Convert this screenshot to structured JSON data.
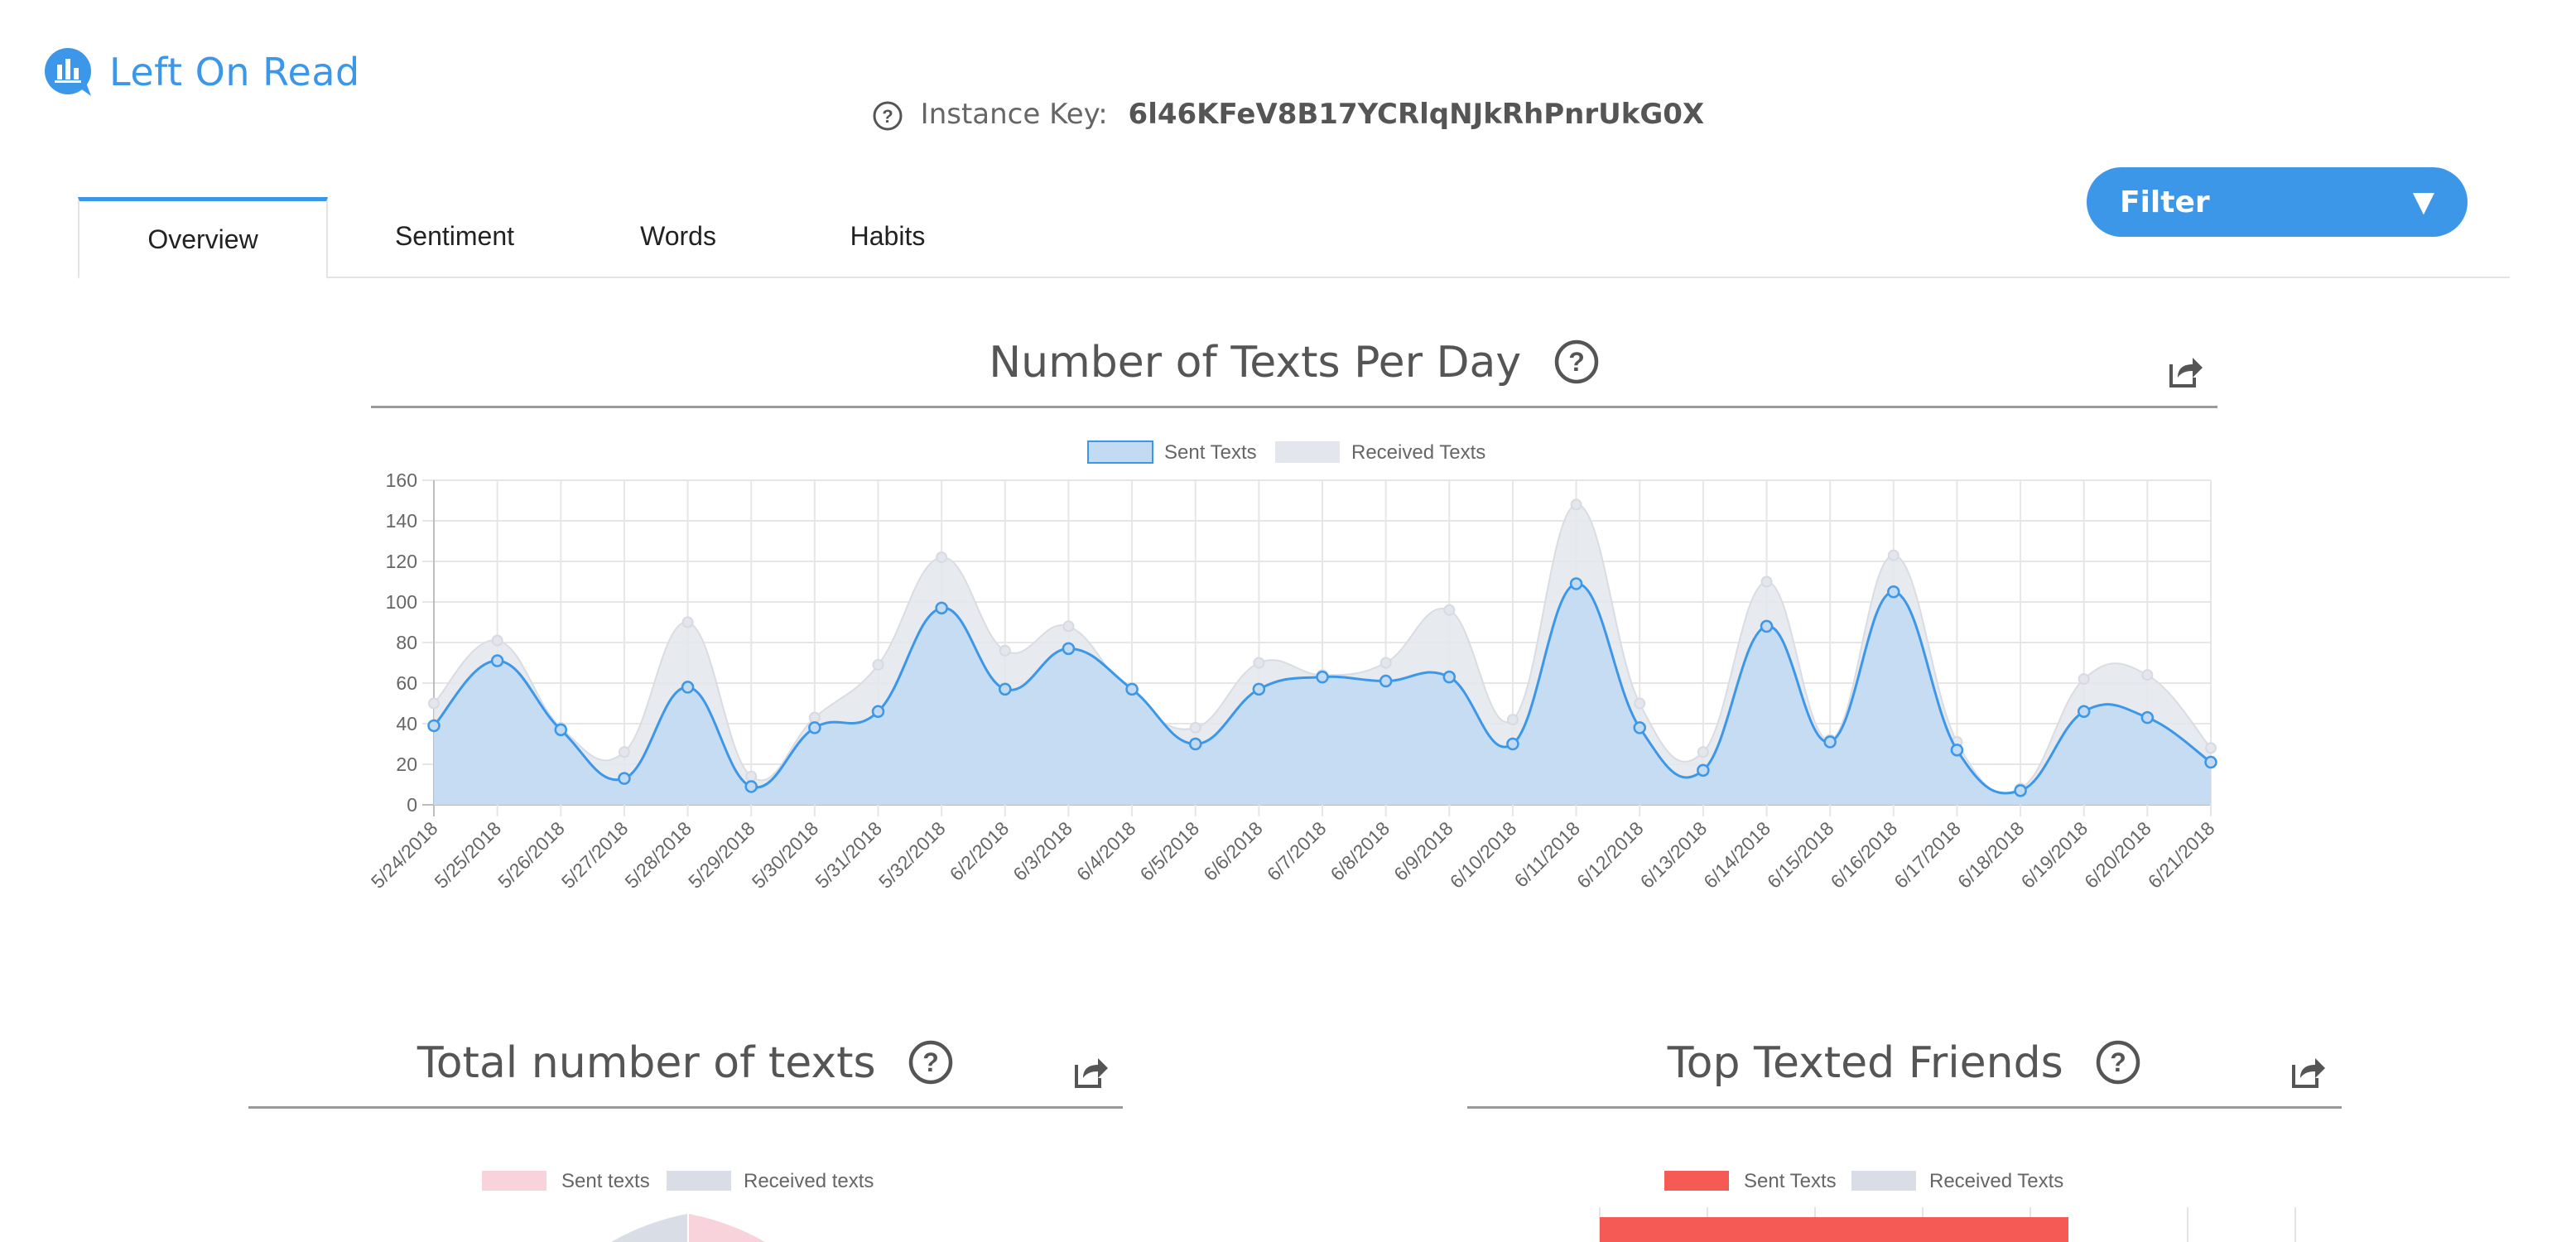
{
  "app": {
    "name": "Left On Read"
  },
  "instance": {
    "label": "Instance Key:",
    "key": "6l46KFeV8B17YCRlqNJkRhPnrUkG0X"
  },
  "tabs": [
    {
      "label": "Overview",
      "active": true
    },
    {
      "label": "Sentiment",
      "active": false
    },
    {
      "label": "Words",
      "active": false
    },
    {
      "label": "Habits",
      "active": false
    }
  ],
  "filter": {
    "label": "Filter",
    "arrow": "▼"
  },
  "sections": {
    "texts_per_day": {
      "title": "Number of Texts Per Day"
    },
    "total_texts": {
      "title": "Total number of texts",
      "legend": [
        "Sent texts",
        "Received texts"
      ]
    },
    "top_friends": {
      "title": "Top Texted Friends",
      "legend": [
        "Sent Texts",
        "Received Texts"
      ]
    }
  },
  "colors": {
    "accent": "#3d97e8",
    "sent_fill": "#c2daf2",
    "received_fill": "#e3e6ec",
    "sent_pink": "#f8d3dc",
    "received_gray": "#d8dde6",
    "friends_sent": "#f65a55",
    "friends_received": "#d8dde6"
  },
  "chart_data": {
    "type": "area",
    "title": "Number of Texts Per Day",
    "x": [
      "5/24/2018",
      "5/25/2018",
      "5/26/2018",
      "5/27/2018",
      "5/28/2018",
      "5/29/2018",
      "5/30/2018",
      "5/31/2018",
      "5/32/2018",
      "6/2/2018",
      "6/3/2018",
      "6/4/2018",
      "6/5/2018",
      "6/6/2018",
      "6/7/2018",
      "6/8/2018",
      "6/9/2018",
      "6/10/2018",
      "6/11/2018",
      "6/12/2018",
      "6/13/2018",
      "6/14/2018",
      "6/15/2018",
      "6/16/2018",
      "6/17/2018",
      "6/18/2018",
      "6/19/2018",
      "6/20/2018",
      "6/21/2018"
    ],
    "series": [
      {
        "name": "Sent Texts",
        "values": [
          39,
          71,
          37,
          13,
          58,
          9,
          38,
          46,
          97,
          57,
          77,
          57,
          30,
          57,
          63,
          61,
          63,
          30,
          109,
          38,
          17,
          88,
          31,
          105,
          27,
          7,
          46,
          43,
          21
        ]
      },
      {
        "name": "Received Texts",
        "values": [
          50,
          81,
          38,
          26,
          90,
          14,
          43,
          69,
          122,
          76,
          88,
          53,
          38,
          70,
          64,
          70,
          96,
          42,
          148,
          50,
          26,
          110,
          32,
          123,
          31,
          8,
          62,
          64,
          28
        ]
      }
    ],
    "ylim": [
      0,
      160
    ],
    "yticks": [
      0,
      20,
      40,
      60,
      80,
      100,
      120,
      140,
      160
    ],
    "grid": true,
    "legend": "top"
  }
}
